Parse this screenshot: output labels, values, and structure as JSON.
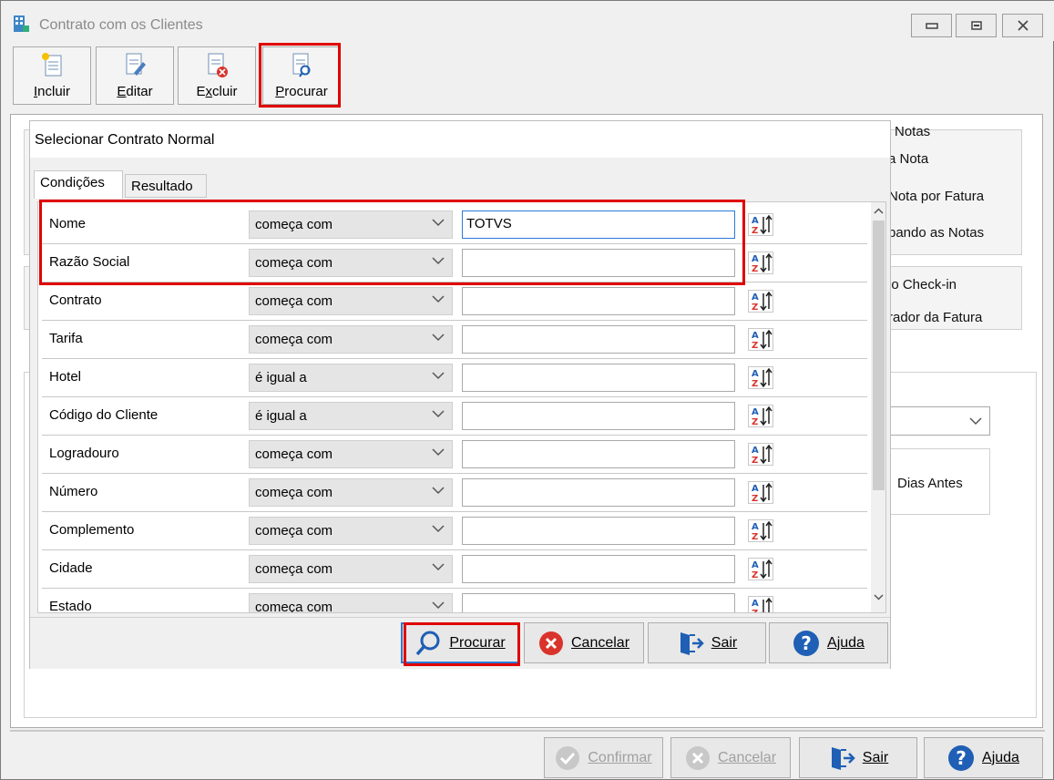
{
  "window": {
    "title": "Contrato com os Clientes"
  },
  "toolbar": [
    {
      "key": "incluir",
      "label": "Incluir",
      "mnemonic": "I",
      "rest": "ncluir"
    },
    {
      "key": "editar",
      "label": "Editar",
      "mnemonic": "E",
      "rest": "ditar"
    },
    {
      "key": "excluir",
      "label": "Excluir",
      "mnemonic": "x",
      "pre": "E",
      "rest": "cluir"
    },
    {
      "key": "procurar",
      "label": "Procurar",
      "mnemonic": "P",
      "rest": "rocurar"
    }
  ],
  "background": {
    "notas_title": "Notas",
    "line1": "a Nota",
    "line2": "Nota por Fatura",
    "line3": "pando as Notas",
    "line4": "lo Check-in",
    "line5": "rador da Fatura",
    "dias_antes": "Dias Antes"
  },
  "dialog": {
    "title": "Selecionar Contrato Normal",
    "tabs": [
      "Condições",
      "Resultado"
    ],
    "rows": [
      {
        "label": "Nome",
        "operator": "começa com",
        "value": "TOTVS"
      },
      {
        "label": "Razão Social",
        "operator": "começa com",
        "value": ""
      },
      {
        "label": "Contrato",
        "operator": "começa com",
        "value": ""
      },
      {
        "label": "Tarifa",
        "operator": "começa com",
        "value": ""
      },
      {
        "label": "Hotel",
        "operator": "é igual a",
        "value": ""
      },
      {
        "label": "Código do Cliente",
        "operator": "é igual a",
        "value": ""
      },
      {
        "label": "Logradouro",
        "operator": "começa com",
        "value": ""
      },
      {
        "label": "Número",
        "operator": "começa com",
        "value": ""
      },
      {
        "label": "Complemento",
        "operator": "começa com",
        "value": ""
      },
      {
        "label": "Cidade",
        "operator": "começa com",
        "value": ""
      },
      {
        "label": "Estado",
        "operator": "começa com",
        "value": ""
      }
    ],
    "buttons": {
      "procurar": "Procurar",
      "cancelar": "Cancelar",
      "sair": "Sair",
      "ajuda": "Ajuda"
    }
  },
  "footer": {
    "confirmar": "Confirmar",
    "cancelar": "Cancelar",
    "sair": "Sair",
    "ajuda": "Ajuda"
  },
  "colors": {
    "highlight": "#e00000",
    "focus": "#2b7bd6",
    "help_blue": "#1f5fb5",
    "cancel_red": "#d9342b"
  }
}
